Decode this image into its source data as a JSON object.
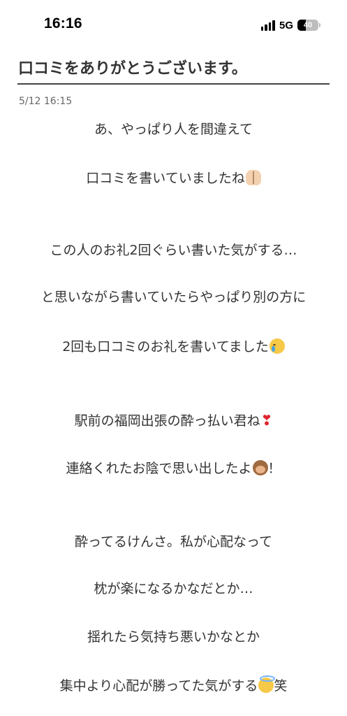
{
  "status_bar": {
    "time": "16:16",
    "network": "5G",
    "battery": "40",
    "battery_level_percent": 40,
    "signal_bars": 4
  },
  "header": {
    "title": "口コミをありがとうございます。"
  },
  "post": {
    "date": "5/12 16:15",
    "lines": [
      {
        "text": "あ、やっぱり人を間違えて",
        "emoji": "",
        "suffix": ""
      },
      {
        "text": "口コミを書いていましたね",
        "emoji": "folded-hands-emoji",
        "suffix": ""
      },
      {
        "text": "この人のお礼2回ぐらい書いた気がする…",
        "emoji": "",
        "suffix": ""
      },
      {
        "text": "と思いながら書いていたらやっぱり別の方に",
        "emoji": "",
        "suffix": ""
      },
      {
        "text": "2回も口コミのお礼を書いてました",
        "emoji": "crying-face-emoji",
        "suffix": ""
      },
      {
        "text": "駅前の福岡出張の酔っ払い君ね",
        "emoji": "heart-exclamation-emoji",
        "suffix": ""
      },
      {
        "text": "連絡くれたお陰で思い出したよ",
        "emoji": "see-no-evil-monkey-emoji",
        "suffix": "！"
      },
      {
        "text": "酔ってるけんさ。私が心配なって",
        "emoji": "",
        "suffix": ""
      },
      {
        "text": "枕が楽になるかなだとか…",
        "emoji": "",
        "suffix": ""
      },
      {
        "text": "揺れたら気持ち悪いかなとか",
        "emoji": "",
        "suffix": ""
      },
      {
        "text": "集中より心配が勝ってた気がする",
        "emoji": "smiling-face-with-halo-emoji",
        "suffix": "笑"
      }
    ]
  },
  "colors": {
    "text": "#333333",
    "rule": "#444444",
    "date": "#666666",
    "background": "#ffffff"
  }
}
